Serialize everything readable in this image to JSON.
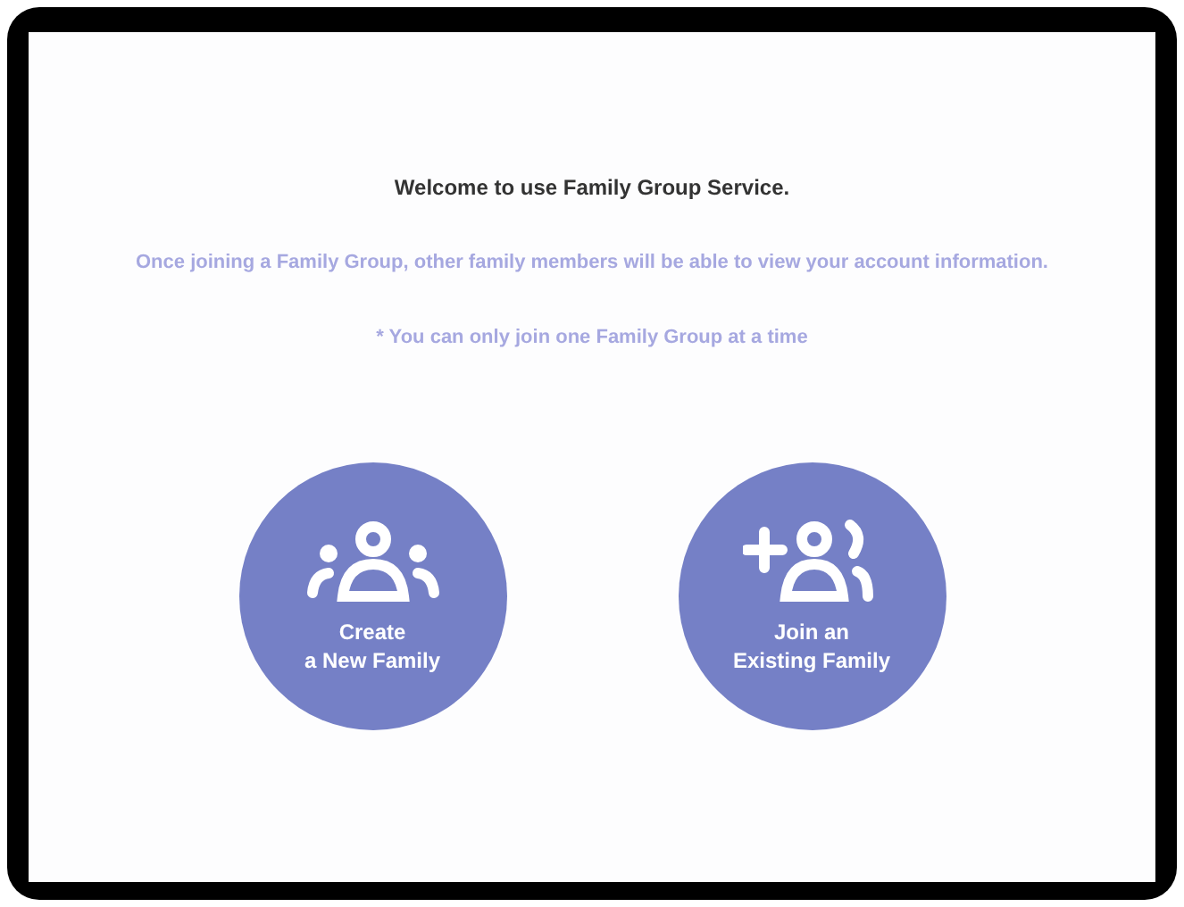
{
  "title": "Welcome to use Family Group Service.",
  "notice": "Once joining a Family Group, other family members will be able to view your account information.",
  "note": "* You can only join one Family Group at a time",
  "actions": [
    {
      "kind": "create",
      "label": "Create\na New Family"
    },
    {
      "kind": "join",
      "label": "Join an\nExisting Family"
    }
  ]
}
